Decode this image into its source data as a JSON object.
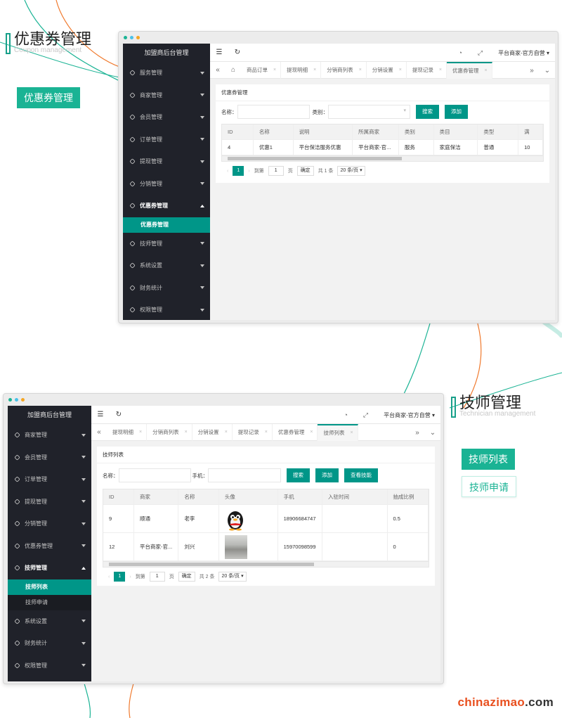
{
  "section1": {
    "title_cn": "优惠券管理",
    "title_en": "Coupon management",
    "pill": "优惠券管理"
  },
  "section2": {
    "title_cn": "技师管理",
    "title_en": "Technician management",
    "pills": [
      "技师列表",
      "技师申请"
    ]
  },
  "brand": {
    "name": "chinazimao",
    "domain": ".com"
  },
  "colors": {
    "accent": "#009688",
    "sidebar": "#20222a",
    "brand": "#e9501f",
    "deco_teal": "#1ab394",
    "deco_orange": "#f07a2e"
  },
  "app": {
    "title": "加盟商后台管理",
    "user": "平台商家-官方自营",
    "icons": [
      "menu-fold-icon",
      "refresh-icon",
      "theme-icon",
      "fullscreen-icon"
    ]
  },
  "win1": {
    "sidebar": [
      {
        "label": "服务管理"
      },
      {
        "label": "商家管理"
      },
      {
        "label": "会员管理"
      },
      {
        "label": "订单管理"
      },
      {
        "label": "提现管理"
      },
      {
        "label": "分销管理"
      },
      {
        "label": "优惠券管理",
        "open": true
      },
      {
        "label": "技师管理"
      },
      {
        "label": "系统设置"
      },
      {
        "label": "财务统计"
      },
      {
        "label": "权限管理"
      }
    ],
    "submenu": [
      "优惠券管理"
    ],
    "tabs": [
      "商品订单",
      "提现明细",
      "分销商列表",
      "分销设置",
      "提现记录",
      "优惠券管理"
    ],
    "panel_title": "优惠券管理",
    "form": {
      "name_label": "名称：",
      "type_label": "类别：",
      "search": "搜索",
      "add": "添加"
    },
    "table": {
      "headers": [
        "ID",
        "名称",
        "说明",
        "所属商家",
        "类别",
        "类目",
        "类型",
        "满"
      ],
      "rows": [
        [
          "4",
          "优惠1",
          "平台保洁服务优惠",
          "平台商家-官...",
          "服务",
          "家庭保洁",
          "普通",
          "10"
        ]
      ]
    },
    "pager": {
      "current": "1",
      "goto": "到第",
      "page_value": "1",
      "page_unit": "页",
      "confirm": "确定",
      "total": "共 1 条",
      "per_page": "20 条/页"
    }
  },
  "win2": {
    "sidebar": [
      {
        "label": "商家管理"
      },
      {
        "label": "会员管理"
      },
      {
        "label": "订单管理"
      },
      {
        "label": "提现管理"
      },
      {
        "label": "分销管理"
      },
      {
        "label": "优惠券管理"
      },
      {
        "label": "技师管理",
        "open": true
      },
      {
        "label": "系统设置"
      },
      {
        "label": "财务统计"
      },
      {
        "label": "权限管理"
      }
    ],
    "submenu": [
      "技师列表",
      "技师申请"
    ],
    "tabs": [
      "提现明细",
      "分销商列表",
      "分销设置",
      "提现记录",
      "优惠券管理",
      "技师列表"
    ],
    "panel_title": "技师列表",
    "form": {
      "name_label": "名称：",
      "phone_label": "手机：",
      "search": "搜索",
      "add": "添加",
      "skills": "查看技能"
    },
    "table": {
      "headers": [
        "ID",
        "商家",
        "名称",
        "头像",
        "手机",
        "入驻时间",
        "抽成比例"
      ],
      "rows": [
        [
          "9",
          "顺通",
          "老李",
          "",
          "18906684747",
          "",
          "0.5"
        ],
        [
          "12",
          "平台商家-官...",
          "刘兴",
          "",
          "15970098599",
          "",
          "0"
        ]
      ]
    },
    "pager": {
      "current": "1",
      "goto": "到第",
      "page_value": "1",
      "page_unit": "页",
      "confirm": "确定",
      "total": "共 2 条",
      "per_page": "20 条/页"
    }
  }
}
